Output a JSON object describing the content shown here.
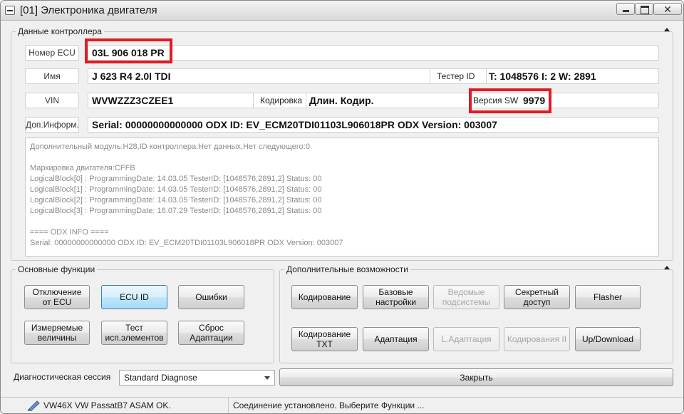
{
  "window": {
    "title": "[01] Электроника двигателя",
    "close_symbol": "✕"
  },
  "controller": {
    "group_title": "Данные контроллера",
    "ecu_number_label": "Номер ECU",
    "ecu_number": "03L 906 018 PR",
    "name_label": "Имя",
    "name": "J 623 R4 2.0l TDI",
    "tester_id_label": "Тестер ID",
    "tester_id": "T: 1048576 I: 2 W: 2891",
    "vin_label": "VIN",
    "vin": "WVWZZZ3CZEE1",
    "coding_label": "Кодировка",
    "coding": "Длин. Кодир.",
    "sw_version_label": "Версия SW",
    "sw_version": "9979",
    "extra_info_label": "Доп.Информ.",
    "extra_info": "Serial: 00000000000000 ODX ID: EV_ECM20TDI01103L906018PR ODX Version: 003007",
    "info_lines": [
      "Дополнительный модуль:H28,ID контроллера:Нет данных,Нет следующего:0",
      "",
      "Маркировка двигателя:CFFB",
      "LogicalBlock[0] : ProgrammingDate: 14.03.05 TesterID: [1048576,2891,2] Status: 00",
      "LogicalBlock[1] : ProgrammingDate: 14.03.05 TesterID: [1048576,2891,2] Status: 00",
      "LogicalBlock[2] : ProgrammingDate: 14.03.05 TesterID: [1048576,2891,2] Status: 00",
      "LogicalBlock[3] : ProgrammingDate: 16.07.29 TesterID: [1048576,2891,2] Status: 00",
      "",
      "====  ODX INFO ====",
      "Serial: 00000000000000 ODX ID: EV_ECM20TDI01103L906018PR ODX Version: 003007"
    ]
  },
  "main_functions": {
    "group_title": "Основные функции",
    "buttons": {
      "disconnect": "Отключение от ECU",
      "ecu_id": "ECU ID",
      "errors": "Ошибки",
      "measured": "Измеряемые величины",
      "test": "Тест исп.элементов",
      "reset": "Сброс Адаптации"
    }
  },
  "extra_functions": {
    "group_title": "Дополнительные возможности",
    "buttons": {
      "coding": "Кодирование",
      "basic": "Базовые настройки",
      "slave": "Ведомые подсистемы",
      "secret": "Секретный доступ",
      "flasher": "Flasher",
      "coding_txt": "Кодирование TXT",
      "adaptation": "Адаптация",
      "l_adaptation": "L.Адаптация",
      "coding2": "Кодирования II",
      "updown": "Up/Download"
    }
  },
  "session": {
    "label": "Диагностическая сессия",
    "value": "Standard Diagnose"
  },
  "close_button": "Закрыть",
  "status": {
    "left": "VW46X VW PassatB7 ASAM OK.",
    "right": "Соединение установлено. Выберите Функции ..."
  },
  "colors": {
    "highlight": "#e01b24",
    "active_button": "#bee6fd"
  }
}
